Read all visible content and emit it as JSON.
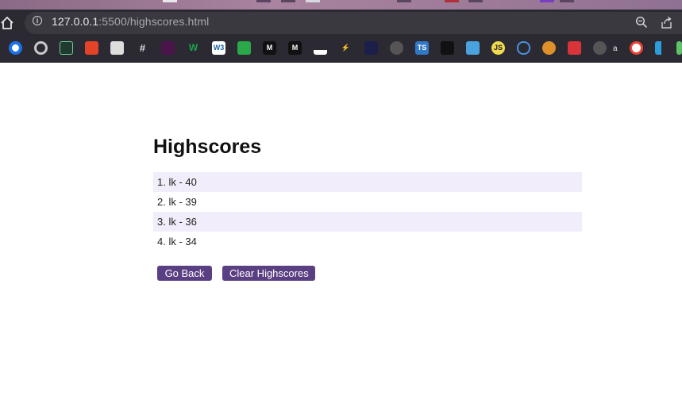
{
  "browser": {
    "url_host": "127.0.0.1",
    "url_rest": ":5500/highscores.html",
    "bookmark_label": "a"
  },
  "page": {
    "title": "Highscores",
    "scores": [
      "1. lk - 40",
      "2. lk - 39",
      "3. lk - 36",
      "4. lk - 34"
    ],
    "go_back_label": "Go Back",
    "clear_label": "Clear Highscores"
  },
  "colors": {
    "button_bg": "#5b3f83",
    "row_highlight": "#f2edfa",
    "chrome_bg": "#2b2a33"
  },
  "icons": {
    "home": "home-icon",
    "info": "info-icon",
    "zoom": "zoom-icon",
    "share": "share-icon"
  }
}
